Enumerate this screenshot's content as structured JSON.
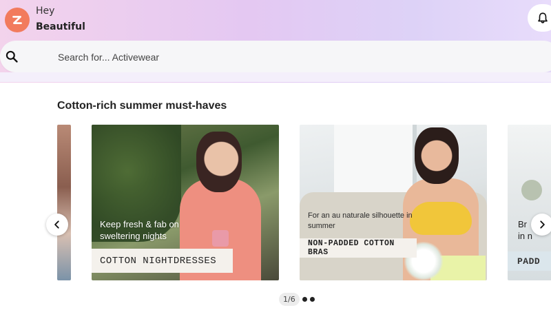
{
  "header": {
    "greeting": "Hey",
    "user_name": "Beautiful",
    "logo_icon": "zivame-logo",
    "notification_icon": "bell-icon"
  },
  "search": {
    "icon": "search-icon",
    "placeholder": "Search for... Activewear"
  },
  "section": {
    "title": "Cotton-rich summer must-haves"
  },
  "carousel": {
    "cards": [
      {
        "promo_text": "Keep fresh & fab on sweltering nights",
        "tag": "COTTON NIGHTDRESSES"
      },
      {
        "promo_text": "For an au naturale silhouette in summer",
        "tag": "NON-PADDED COTTON BRAS"
      }
    ],
    "partial_right": {
      "promo_text_line1": "Br",
      "promo_text_line2": "in n",
      "tag": "PADD"
    },
    "prev_icon": "chevron-left-icon",
    "next_icon": "chevron-right-icon",
    "pager": {
      "label": "1/6",
      "dots": 2
    }
  },
  "colors": {
    "logo": "#f27b5d",
    "header_gradient_start": "#f3d3ec",
    "header_gradient_end": "#e8dcfb"
  }
}
